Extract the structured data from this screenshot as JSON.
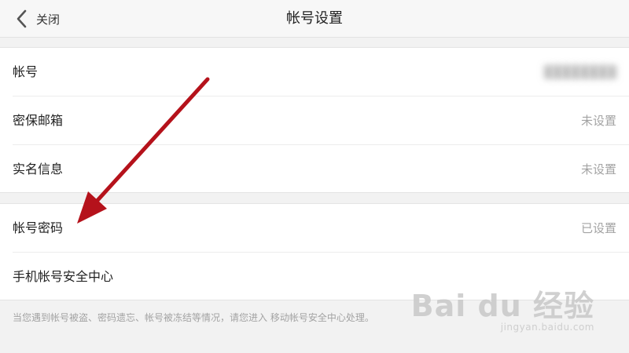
{
  "header": {
    "back_label": "关闭",
    "title": "帐号设置",
    "back_icon": "chevron-left-icon"
  },
  "settings_group_1": [
    {
      "label": "帐号",
      "value": "",
      "blurred": true
    },
    {
      "label": "密保邮箱",
      "value": "未设置"
    },
    {
      "label": "实名信息",
      "value": "未设置"
    }
  ],
  "settings_group_2": [
    {
      "label": "帐号密码",
      "value": "已设置"
    },
    {
      "label": "手机帐号安全中心",
      "value": ""
    }
  ],
  "notice": "当您遇到帐号被盗、密码遗忘、帐号被冻结等情况，请您进入 移动帐号安全中心处理。",
  "watermark": {
    "logo": "Bai du 经验",
    "url": "jingyan.baidu.com"
  },
  "colors": {
    "annotation_arrow": "#b5121b",
    "secondary_text": "#a3a3a3",
    "background": "#f2f2f2"
  }
}
